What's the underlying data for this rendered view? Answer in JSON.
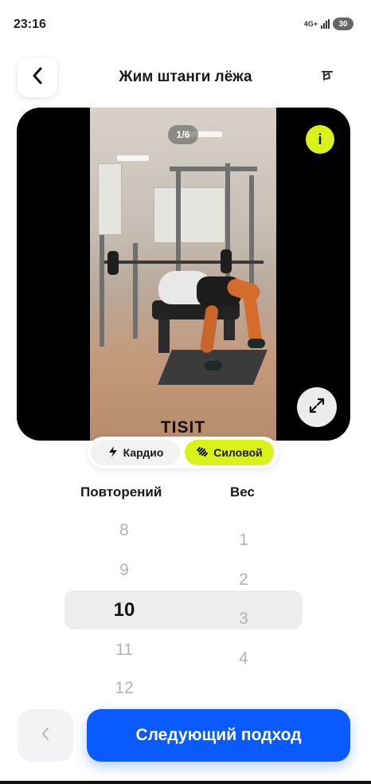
{
  "status_bar": {
    "time": "23:16",
    "network": "4G+",
    "battery": "30"
  },
  "header": {
    "title": "Жим штанги лёжа",
    "back_icon": "chevron-left-icon",
    "edit_icon": "edit-icon"
  },
  "media": {
    "counter": "1/6",
    "watermark": "TISIT",
    "info_label": "i",
    "expand_icon": "expand-icon"
  },
  "mode_toggle": {
    "options": [
      {
        "label": "Кардио",
        "icon": "lightning-icon",
        "selected": false
      },
      {
        "label": "Силовой",
        "icon": "dumbbell-icon",
        "selected": true
      }
    ]
  },
  "pickers": {
    "reps": {
      "label": "Повторений",
      "values": [
        "8",
        "9",
        "10",
        "11",
        "12"
      ],
      "selected": "10"
    },
    "weight": {
      "label": "Вес",
      "values": [
        "1",
        "2",
        "3",
        "4"
      ],
      "selected": "3"
    }
  },
  "footer": {
    "prev_icon": "chevron-left-icon",
    "next_label": "Следующий подход"
  },
  "colors": {
    "accent": "#d9f21a",
    "primary": "#0a5bff"
  }
}
